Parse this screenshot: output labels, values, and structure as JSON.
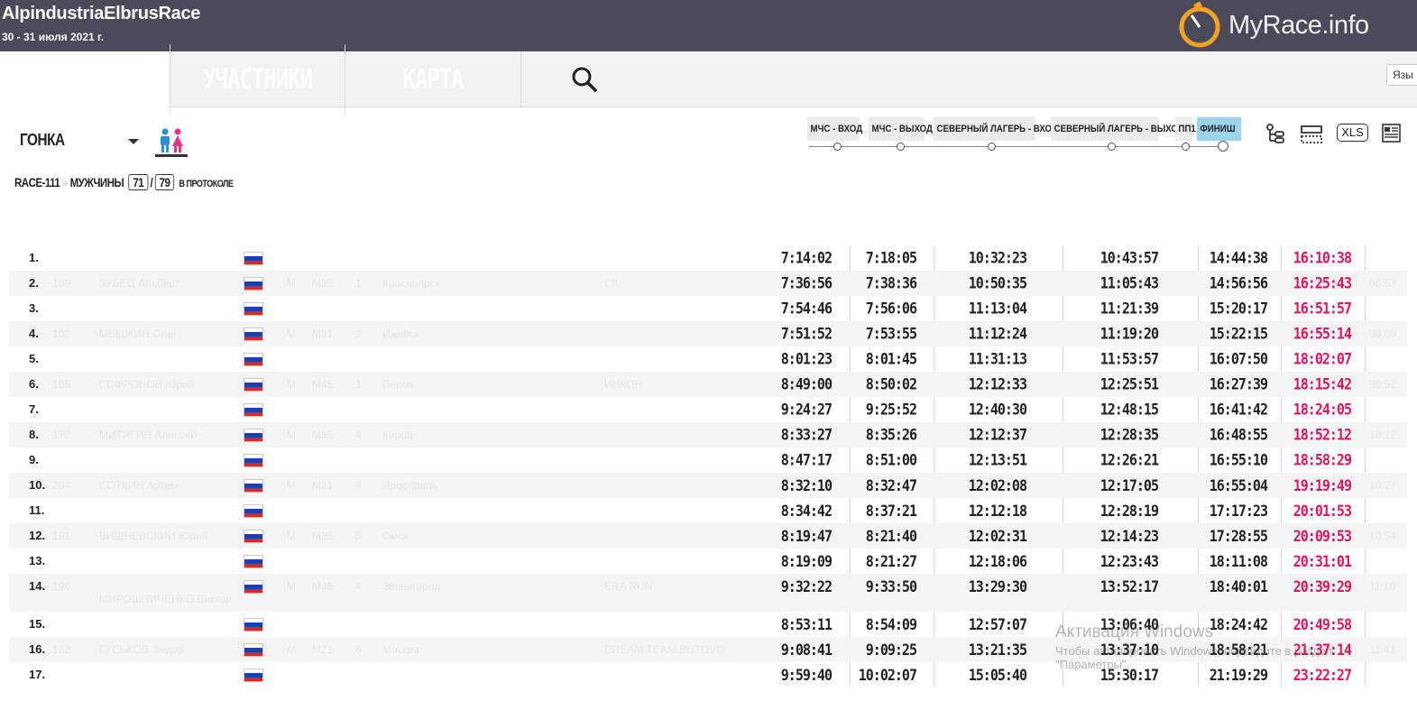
{
  "header": {
    "title": "AlpindustriaElbrusRace",
    "date": "30 - 31 июля 2021 г.",
    "brand": "MyRace.info"
  },
  "nav": {
    "tabs": [
      {
        "label": "УЧАСТНИКИ"
      },
      {
        "label": "КАРТА"
      }
    ],
    "language_label": "Язы"
  },
  "filters": {
    "race_label": "ГОНКА",
    "race_code": "RACE-111",
    "category": "МУЖЧИНЫ",
    "count_shown": "71",
    "count_total": "79",
    "count_suffix": "В ПРОТОКОЛЕ"
  },
  "checkpoints": [
    {
      "label": "МЧС - ВХОД"
    },
    {
      "label": "МЧС - ВЫХОД"
    },
    {
      "label": "СЕВЕРНЫЙ ЛАГЕРЬ - ВХОД"
    },
    {
      "label": "СЕВЕРНЫЙ ЛАГЕРЬ - ВЫХОД"
    },
    {
      "label": "ПП1"
    },
    {
      "label": "ФИНИШ"
    }
  ],
  "tools": {
    "xls_label": "XLS"
  },
  "colors": {
    "topbar": "#4a4a5a",
    "finish": "#e5135f",
    "active_tab": "#9ed3ee",
    "brand_orange": "#f4a21f"
  },
  "results": [
    {
      "pos": "1.",
      "bib": "",
      "name": "",
      "gender": "",
      "group": "",
      "group_place": "",
      "city": "",
      "team": "",
      "times": [
        "7:14:02",
        "7:18:05",
        "10:32:23",
        "10:43:57",
        "14:44:38",
        "16:10:38"
      ],
      "extra": ""
    },
    {
      "pos": "2.",
      "bib": "169",
      "name": "ЗУБЕЦ Альберт",
      "gender": "M",
      "group": "M35",
      "group_place": "1",
      "city": "Красноярск",
      "team": "СК",
      "times": [
        "7:36:56",
        "7:38:36",
        "10:50:35",
        "11:05:43",
        "14:56:56",
        "16:25:43"
      ],
      "extra": "06:53"
    },
    {
      "pos": "3.",
      "bib": "",
      "name": "",
      "gender": "",
      "group": "",
      "group_place": "",
      "city": "",
      "team": "",
      "times": [
        "7:54:46",
        "7:56:06",
        "11:13:04",
        "11:21:39",
        "15:20:17",
        "16:51:57"
      ],
      "extra": ""
    },
    {
      "pos": "4.",
      "bib": "102",
      "name": "МЫШКИН Олег",
      "gender": "M",
      "group": "M21",
      "group_place": "2",
      "city": "Ижевск",
      "team": "",
      "times": [
        "7:51:52",
        "7:53:55",
        "11:12:24",
        "11:19:20",
        "15:22:15",
        "16:55:14"
      ],
      "extra": "09:09"
    },
    {
      "pos": "5.",
      "bib": "",
      "name": "",
      "gender": "",
      "group": "",
      "group_place": "",
      "city": "",
      "team": "",
      "times": [
        "8:01:23",
        "8:01:45",
        "11:31:13",
        "11:53:57",
        "16:07:50",
        "18:02:07"
      ],
      "extra": ""
    },
    {
      "pos": "6.",
      "bib": "105",
      "name": "СОФРОНОВ Юрий",
      "gender": "M",
      "group": "M45",
      "group_place": "1",
      "city": "Пермь",
      "team": "ИНКОН",
      "times": [
        "8:49:00",
        "8:50:02",
        "12:12:33",
        "12:25:51",
        "16:27:39",
        "18:15:42"
      ],
      "extra": "09:52"
    },
    {
      "pos": "7.",
      "bib": "",
      "name": "",
      "gender": "",
      "group": "",
      "group_place": "",
      "city": "",
      "team": "",
      "times": [
        "9:24:27",
        "9:25:52",
        "12:40:30",
        "12:48:15",
        "16:41:42",
        "18:24:05"
      ],
      "extra": ""
    },
    {
      "pos": "8.",
      "bib": "170",
      "name": "МИТЯГИН Алексей",
      "gender": "M",
      "group": "M35",
      "group_place": "4",
      "city": "Киров",
      "team": "",
      "times": [
        "8:33:27",
        "8:35:26",
        "12:12:37",
        "12:28:35",
        "16:48:55",
        "18:52:12"
      ],
      "extra": "10:12"
    },
    {
      "pos": "9.",
      "bib": "",
      "name": "",
      "gender": "",
      "group": "",
      "group_place": "",
      "city": "",
      "team": "",
      "times": [
        "8:47:17",
        "8:51:00",
        "12:13:51",
        "12:26:21",
        "16:55:10",
        "18:58:29"
      ],
      "extra": ""
    },
    {
      "pos": "10.",
      "bib": "204",
      "name": "СОТКИН Артем",
      "gender": "M",
      "group": "M21",
      "group_place": "4",
      "city": "Ярославль",
      "team": "",
      "times": [
        "8:32:10",
        "8:32:47",
        "12:02:08",
        "12:17:05",
        "16:55:04",
        "19:19:49"
      ],
      "extra": "10:27"
    },
    {
      "pos": "11.",
      "bib": "",
      "name": "",
      "gender": "",
      "group": "",
      "group_place": "",
      "city": "",
      "team": "",
      "times": [
        "8:34:42",
        "8:37:21",
        "12:12:18",
        "12:28:19",
        "17:17:23",
        "20:01:53"
      ],
      "extra": ""
    },
    {
      "pos": "12.",
      "bib": "191",
      "name": "ВИШНЕВСКИЙ Юрий",
      "gender": "M",
      "group": "M35",
      "group_place": "5",
      "city": "Омск",
      "team": "",
      "times": [
        "8:19:47",
        "8:21:40",
        "12:02:31",
        "12:14:23",
        "17:28:55",
        "20:09:53"
      ],
      "extra": "10:54"
    },
    {
      "pos": "13.",
      "bib": "",
      "name": "",
      "gender": "",
      "group": "",
      "group_place": "",
      "city": "",
      "team": "",
      "times": [
        "8:19:09",
        "8:21:27",
        "12:18:06",
        "12:23:43",
        "18:11:08",
        "20:31:01"
      ],
      "extra": ""
    },
    {
      "pos": "14.",
      "bib": "196",
      "name": "МИРОШНИЧЕНКО Виктор",
      "gender": "M",
      "group": "M45",
      "group_place": "4",
      "city": "Звенигород",
      "team": "ERA RUN",
      "times": [
        "9:32:22",
        "9:33:50",
        "13:29:30",
        "13:52:17",
        "18:40:01",
        "20:39:29"
      ],
      "extra": "11:10"
    },
    {
      "pos": "15.",
      "bib": "",
      "name": "",
      "gender": "",
      "group": "",
      "group_place": "",
      "city": "",
      "team": "",
      "times": [
        "8:53:11",
        "8:54:09",
        "12:57:07",
        "13:06:40",
        "18:24:42",
        "20:49:58"
      ],
      "extra": ""
    },
    {
      "pos": "16.",
      "bib": "162",
      "name": "ГУСЬКОВ Федор",
      "gender": "M",
      "group": "M21",
      "group_place": "6",
      "city": "Москва",
      "team": "DREAM TEAM BUTOVO",
      "times": [
        "9:08:41",
        "9:09:25",
        "13:21:35",
        "13:37:10",
        "18:58:21",
        "21:37:14"
      ],
      "extra": "11:41"
    },
    {
      "pos": "17.",
      "bib": "",
      "name": "",
      "gender": "",
      "group": "",
      "group_place": "",
      "city": "",
      "team": "",
      "times": [
        "9:59:40",
        "10:02:07",
        "15:05:40",
        "15:30:17",
        "21:19:29",
        "23:22:27"
      ],
      "extra": ""
    }
  ],
  "watermark": {
    "line1": "Активация Windows",
    "line2": "Чтобы активировать Windows, перейдите в раздел",
    "line3": "\"Параметры\"."
  }
}
